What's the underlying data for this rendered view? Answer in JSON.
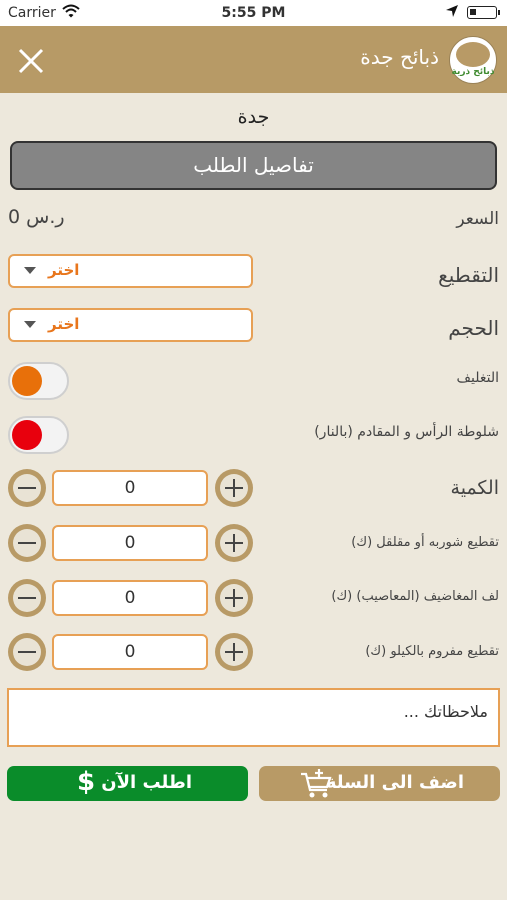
{
  "status_bar": {
    "carrier": "Carrier",
    "time": "5:55 PM"
  },
  "header": {
    "title": "ذبائح جدة",
    "logo_text": "ذبائح ذرية"
  },
  "city": "جدة",
  "details_button": "تفاصيل الطلب",
  "price": {
    "label": "السعر",
    "value": "0 ر.س"
  },
  "cutting": {
    "label": "التقطيع",
    "value": "اختر"
  },
  "size": {
    "label": "الحجم",
    "value": "اختر"
  },
  "packaging": {
    "label": "التغليف",
    "color": "#e8700a"
  },
  "singeing": {
    "label": "شلوطة الرأس و المقادم (بالنار)",
    "color": "#e8000d"
  },
  "steppers": [
    {
      "label": "الكمية",
      "value": "0"
    },
    {
      "label": "تقطيع شوربه أو مقلقل (ك)",
      "value": "0"
    },
    {
      "label": "لف المغاضيف (المعاصيب) (ك)",
      "value": "0"
    },
    {
      "label": "تقطيع مفروم بالكيلو (ك)",
      "value": "0"
    }
  ],
  "notes": {
    "placeholder": "ملاحظاتك ..."
  },
  "order_now": {
    "label": "اطلب الآن",
    "icon": "dollar-icon"
  },
  "add_to_cart": {
    "label": "اضف الى السلة",
    "icon": "cart-add-icon"
  },
  "colors": {
    "accent": "#b89a66",
    "order_green": "#0a8c2a",
    "field_border": "#e7a055"
  }
}
